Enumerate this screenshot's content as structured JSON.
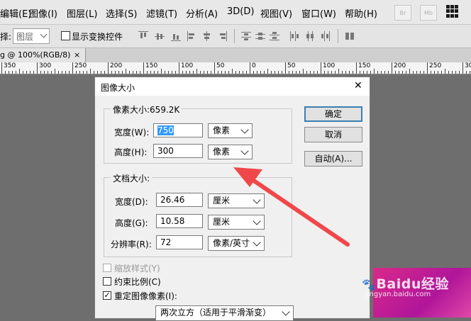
{
  "menubar": {
    "items": [
      "编辑(E)",
      "图像(I)",
      "图层(L)",
      "选择(S)",
      "滤镜(T)",
      "分析(A)",
      "3D(D)",
      "视图(V)",
      "窗口(W)",
      "帮助(H)"
    ],
    "mini_buttons": [
      "Br",
      "Mb"
    ]
  },
  "optbar": {
    "select_label": "择:",
    "select_value": "图层",
    "show_transform_label": "显示变换控件"
  },
  "doc": {
    "tab_title": "g @ 100%(RGB/8)",
    "ruler_labels": [
      "350",
      "300",
      "250",
      "200",
      "150",
      "100",
      "50",
      "0",
      "50",
      "100",
      "150",
      "200",
      "250",
      "300"
    ]
  },
  "dialog": {
    "title": "图像大小",
    "pixel_group_title": "像素大小:659.2K",
    "width_label": "宽度(W):",
    "width_value": "750",
    "width_unit": "像素",
    "height_label": "高度(H):",
    "height_value": "300",
    "height_unit": "像素",
    "doc_group_title": "文档大小:",
    "doc_width_label": "宽度(D):",
    "doc_width_value": "26.46",
    "doc_width_unit": "厘米",
    "doc_height_label": "高度(G):",
    "doc_height_value": "10.58",
    "doc_height_unit": "厘米",
    "resolution_label": "分辨率(R):",
    "resolution_value": "72",
    "resolution_unit": "像素/英寸",
    "ok_label": "确定",
    "cancel_label": "取消",
    "auto_label": "自动(A)...",
    "scale_styles_label": "缩放样式(Y)",
    "constrain_label": "约束比例(C)",
    "resample_label": "重定图像像素(I):",
    "resample_method": "两次立方（适用于平滑渐变）"
  },
  "watermark": {
    "text": "Baidu经验",
    "sub": "jingyan.baidu.com"
  },
  "colors": {
    "annotation_arrow": "#f0484a",
    "selection": "#3399ff",
    "default_button_border": "#3c7fb1"
  }
}
